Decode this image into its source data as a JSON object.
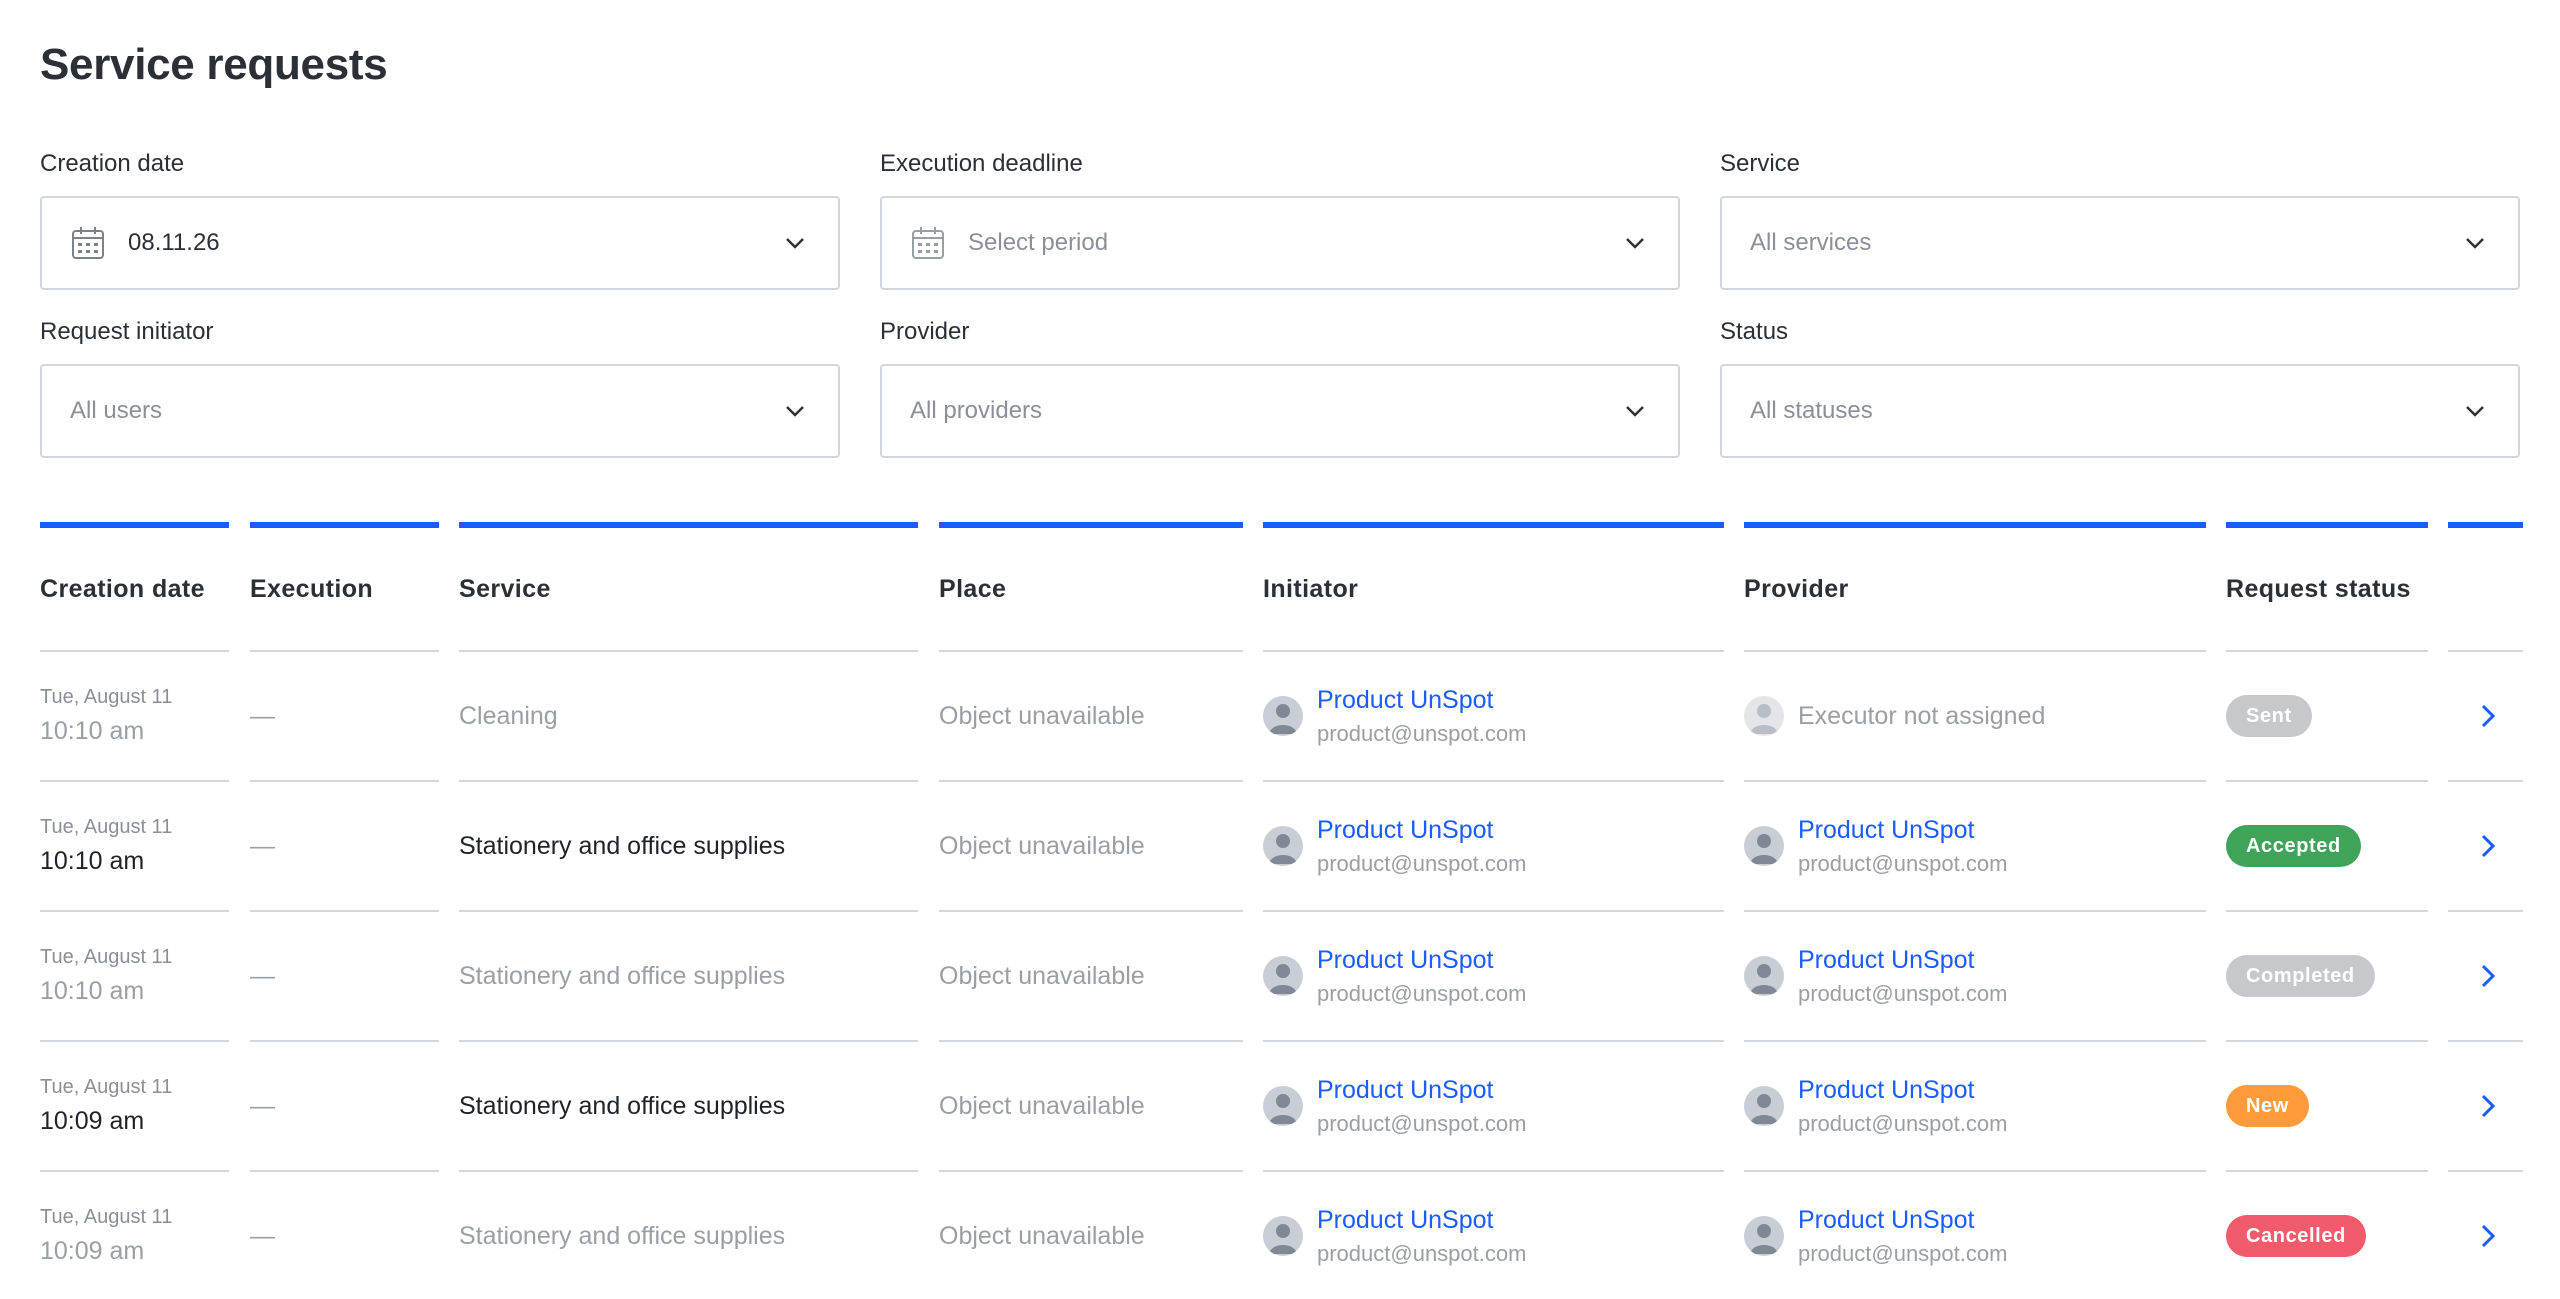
{
  "page": {
    "title": "Service requests"
  },
  "filters": {
    "creation_date": {
      "label": "Creation date",
      "value": "08.11.26"
    },
    "execution_deadline": {
      "label": "Execution deadline",
      "placeholder": "Select period"
    },
    "service": {
      "label": "Service",
      "placeholder": "All services"
    },
    "request_initiator": {
      "label": "Request initiator",
      "placeholder": "All users"
    },
    "provider": {
      "label": "Provider",
      "placeholder": "All providers"
    },
    "status": {
      "label": "Status",
      "placeholder": "All statuses"
    }
  },
  "table": {
    "headers": [
      "Creation date",
      "Execution",
      "Service",
      "Place",
      "Initiator",
      "Provider",
      "Request status",
      ""
    ],
    "rows": [
      {
        "date": "Tue, August 11",
        "time": "10:10 am",
        "execution": "—",
        "service": "Cleaning",
        "place": "Object unavailable",
        "initiator": {
          "name": "Product UnSpot",
          "email": "product@unspot.com"
        },
        "provider": {
          "name": "Executor not assigned",
          "email": ""
        },
        "status": "Sent",
        "status_color": "#c6c8cc",
        "active": false
      },
      {
        "date": "Tue, August 11",
        "time": "10:10 am",
        "execution": "—",
        "service": "Stationery and office supplies",
        "place": "Object unavailable",
        "initiator": {
          "name": "Product UnSpot",
          "email": "product@unspot.com"
        },
        "provider": {
          "name": "Product UnSpot",
          "email": "product@unspot.com"
        },
        "status": "Accepted",
        "status_color": "#3fa45a",
        "active": true
      },
      {
        "date": "Tue, August 11",
        "time": "10:10 am",
        "execution": "—",
        "service": "Stationery and office supplies",
        "place": "Object unavailable",
        "initiator": {
          "name": "Product UnSpot",
          "email": "product@unspot.com"
        },
        "provider": {
          "name": "Product UnSpot",
          "email": "product@unspot.com"
        },
        "status": "Completed",
        "status_color": "#c6c8cc",
        "active": false
      },
      {
        "date": "Tue, August 11",
        "time": "10:09 am",
        "execution": "—",
        "service": "Stationery and office supplies",
        "place": "Object unavailable",
        "initiator": {
          "name": "Product UnSpot",
          "email": "product@unspot.com"
        },
        "provider": {
          "name": "Product UnSpot",
          "email": "product@unspot.com"
        },
        "status": "New",
        "status_color": "#ff9b3d",
        "active": true
      },
      {
        "date": "Tue, August 11",
        "time": "10:09 am",
        "execution": "—",
        "service": "Stationery and office supplies",
        "place": "Object unavailable",
        "initiator": {
          "name": "Product UnSpot",
          "email": "product@unspot.com"
        },
        "provider": {
          "name": "Product UnSpot",
          "email": "product@unspot.com"
        },
        "status": "Cancelled",
        "status_color": "#f25b6c",
        "active": false
      }
    ]
  },
  "colors": {
    "accent": "#1a5cff",
    "border": "#d4d7dc",
    "muted_text": "#9a9ea5"
  },
  "icons": {
    "calendar": "calendar-icon",
    "chevron": "chevron-down-icon",
    "row_open": "chevron-right-icon",
    "avatar": "user-avatar-icon"
  }
}
